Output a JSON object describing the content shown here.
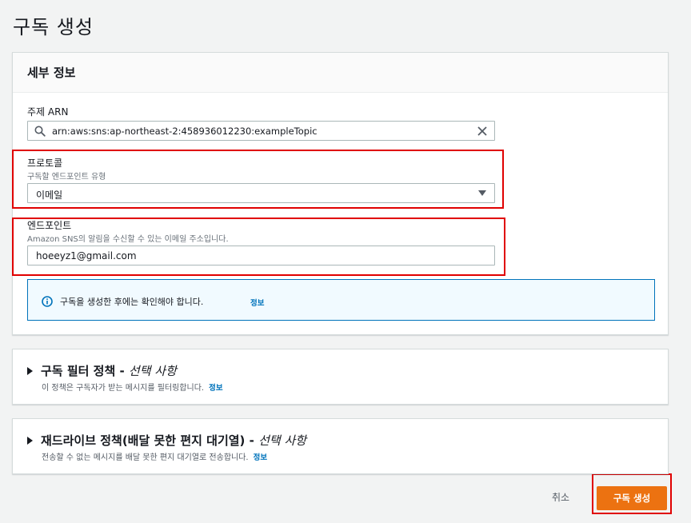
{
  "page": {
    "title": "구독 생성"
  },
  "details": {
    "heading": "세부 정보",
    "topic_arn": {
      "label": "주제 ARN",
      "value": "arn:aws:sns:ap-northeast-2:458936012230:exampleTopic"
    },
    "protocol": {
      "label": "프로토콜",
      "description": "구독할 엔드포인트 유형",
      "value": "이메일"
    },
    "endpoint": {
      "label": "엔드포인트",
      "description": "Amazon SNS의 알림을 수신할 수 있는 이메일 주소입니다.",
      "value": "hoeeyz1@gmail.com"
    },
    "alert": {
      "message": "구독을 생성한 후에는 확인해야 합니다.",
      "link": "정보"
    }
  },
  "filter_policy": {
    "title": "구독 필터 정책 - ",
    "optional": "선택 사항",
    "description": "이 정책은 구독자가 받는 메시지를 필터링합니다.",
    "link": "정보"
  },
  "redrive_policy": {
    "title": "재드라이브 정책(배달 못한 편지 대기열) - ",
    "optional": "선택 사항",
    "description": "전송할 수 없는 메시지를 배달 못한 편지 대기열로 전송합니다.",
    "link": "정보"
  },
  "actions": {
    "cancel": "취소",
    "create": "구독 생성"
  },
  "colors": {
    "primary_button": "#ec7211",
    "link": "#0073bb",
    "highlight": "#e00000"
  }
}
